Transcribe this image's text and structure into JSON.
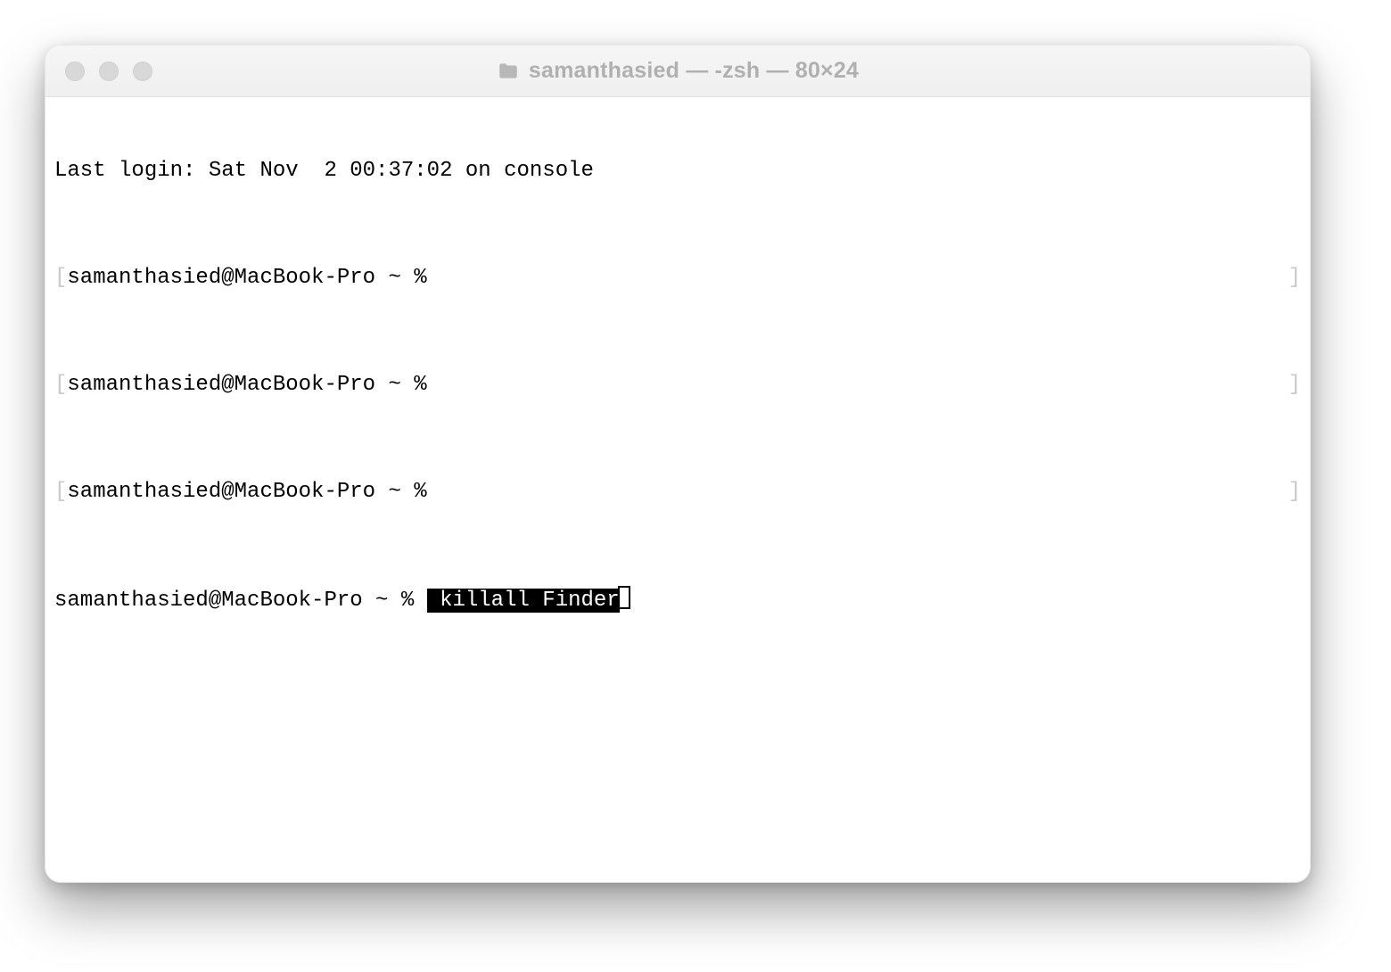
{
  "window": {
    "title": "samanthasied — -zsh — 80×24"
  },
  "terminal": {
    "login_line": "Last login: Sat Nov  2 00:37:02 on console",
    "prompt": "samanthasied@MacBook-Pro ~ % ",
    "empty_prompts": 3,
    "selected_command": " killall Finder"
  },
  "glyphs": {
    "left_bracket": "[",
    "right_bracket": "]"
  }
}
